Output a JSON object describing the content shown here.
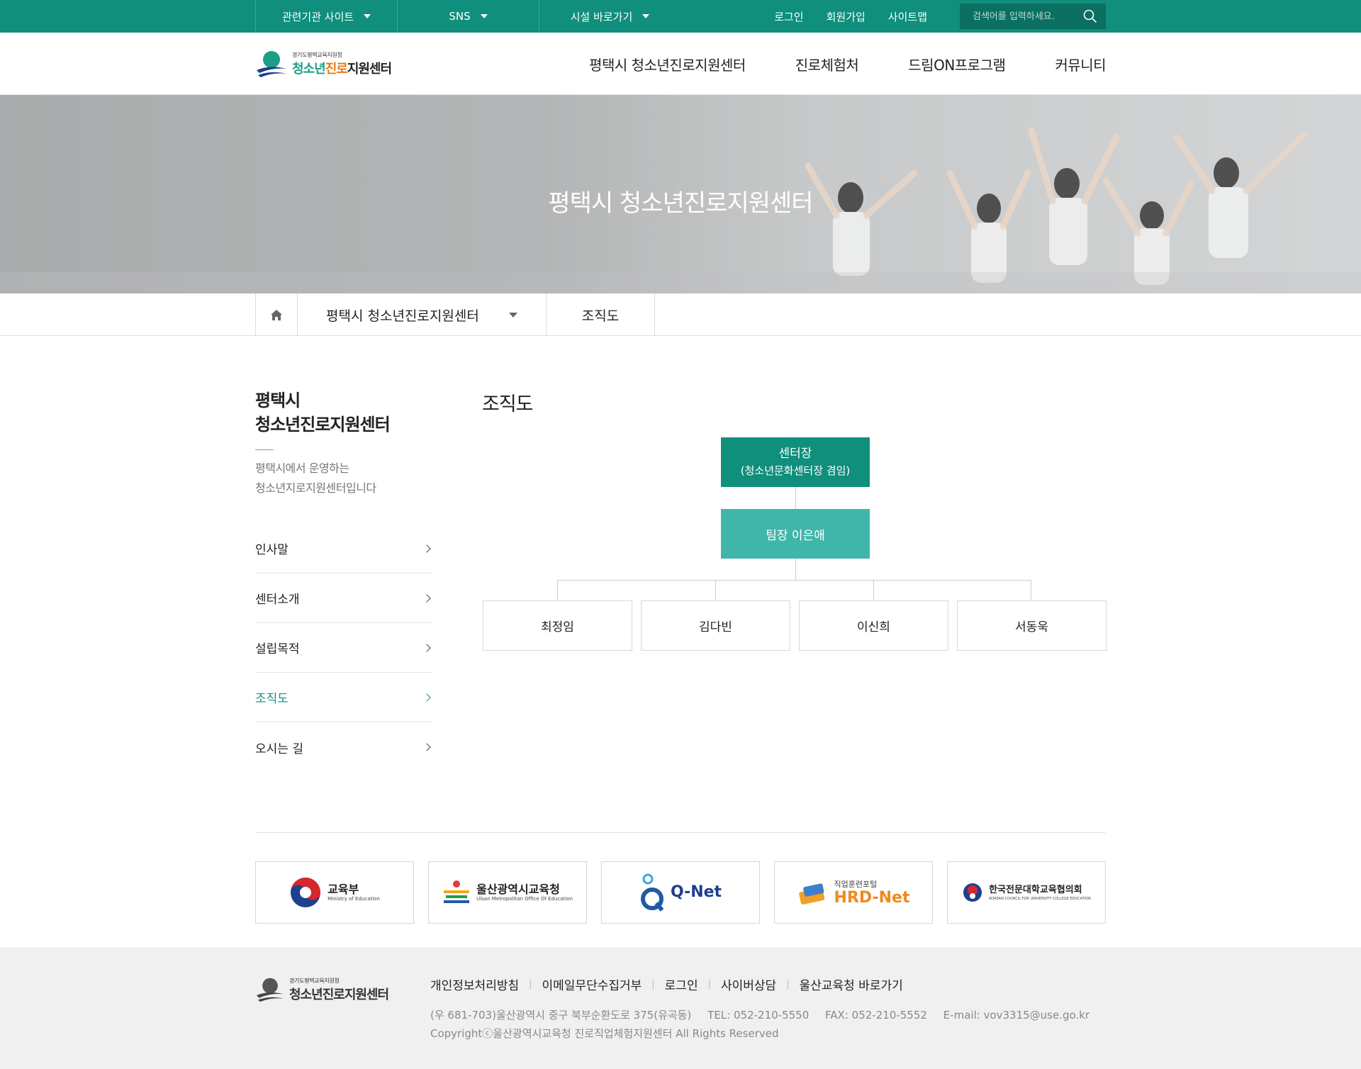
{
  "util": {
    "dropdowns": [
      "관련기관 사이트",
      "SNS",
      "시설 바로가기"
    ],
    "links": [
      "로그인",
      "회원가입",
      "사이트맵"
    ],
    "search_placeholder": "검색어를 입력하세요."
  },
  "logo": {
    "small": "경기도평택교육지원청",
    "a": "청소년",
    "b": "진로",
    "c": "지원센터"
  },
  "gnb": [
    "평택시 청소년진로지원센터",
    "진로체험처",
    "드림ON프로그램",
    "커뮤니티"
  ],
  "visual": {
    "title": "평택시 청소년진로지원센터"
  },
  "location": {
    "depth1": "평택시 청소년진로지원센터",
    "depth2": "조직도"
  },
  "lnb": {
    "title_line1": "평택시",
    "title_line2": "청소년진로지원센터",
    "desc_line1": "평택시에서 운영하는",
    "desc_line2": "청소년지로지원센터입니다",
    "items": [
      "인사말",
      "센터소개",
      "설립목적",
      "조직도",
      "오시는 길"
    ],
    "active_index": 3
  },
  "main": {
    "title": "조직도",
    "head_title": "센터장",
    "head_sub": "(청소년문화센터장 겸임)",
    "lead": "팀장 이은애",
    "members": [
      "최정임",
      "김다빈",
      "이신희",
      "서동욱"
    ]
  },
  "banners": [
    {
      "title": "교육부",
      "sub": "Ministry of Education",
      "icon": "taegeuk-icon"
    },
    {
      "title": "울산광역시교육청",
      "sub": "Ulsan Metropolitan Office Of Education",
      "icon": "ulsan-edu-icon"
    },
    {
      "title": "Q-Net",
      "sub": "",
      "icon": "qnet-icon"
    },
    {
      "title": "HRD-Net",
      "sub": "직업훈련포털",
      "icon": "hrd-icon"
    },
    {
      "title": "한국전문대학교육협의회",
      "sub": "KOREAN COUNCIL FOR UNIVERSITY COLLEGE EDUCATION",
      "icon": "kcce-icon"
    }
  ],
  "footer": {
    "links": [
      "개인정보처리방침",
      "이메일무단수집거부",
      "로그인",
      "사이버상담",
      "울산교육청 바로가기"
    ],
    "address": "(우 681-703)울산광역시 중구 북부순환도로 375(유곡동)",
    "tel": "TEL: 052-210-5550",
    "fax": "FAX: 052-210-5552",
    "email": "E-mail: vov3315@use.go.kr",
    "copyright": "Copyrightⓒ울산광역시교육청 진로직업체험지원센터 All Rights Reserved"
  },
  "colors": {
    "primary": "#0f8f7c",
    "lead": "#40b6aa",
    "footer_bg": "#f0f0f0"
  }
}
